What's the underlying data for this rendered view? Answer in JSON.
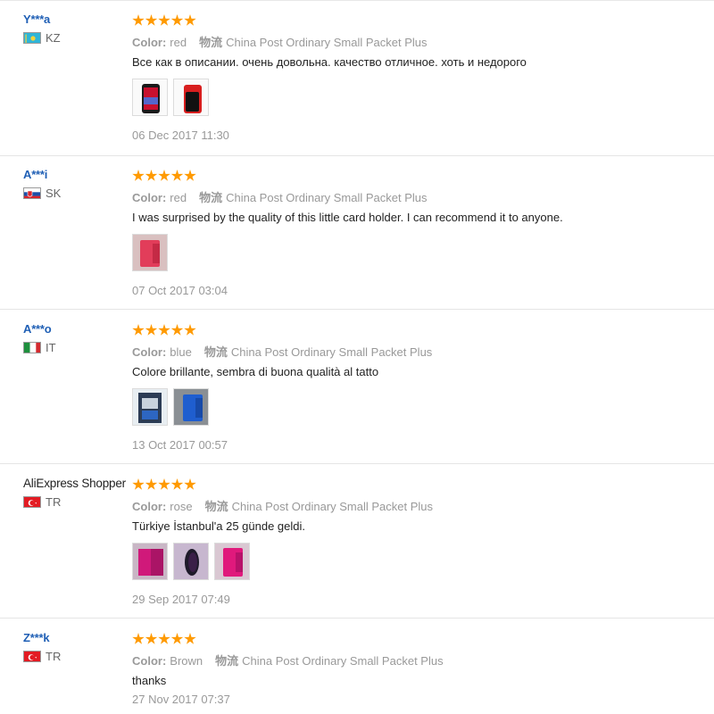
{
  "labels": {
    "color": "Color:",
    "logistics": "物流"
  },
  "reviews": [
    {
      "user": "Y***a",
      "country": "KZ",
      "flag": "kz",
      "rating": 5,
      "color": "red",
      "shipping": "China Post Ordinary Small Packet Plus",
      "text": "Все как в описании. очень довольна. качество отличное. хоть и недорого",
      "photos": [
        "phone-case-red-dark",
        "phone-case-red-black"
      ],
      "date": "06 Dec 2017 11:30"
    },
    {
      "user": "A***i",
      "country": "SK",
      "flag": "sk",
      "rating": 5,
      "color": "red",
      "shipping": "China Post Ordinary Small Packet Plus",
      "text": "I was surprised by the quality of this little card holder. I can recommend it to anyone.",
      "photos": [
        "card-holder-pink"
      ],
      "date": "07 Oct 2017 03:04"
    },
    {
      "user": "A***o",
      "country": "IT",
      "flag": "it",
      "rating": 5,
      "color": "blue",
      "shipping": "China Post Ordinary Small Packet Plus",
      "text": "Colore brillante, sembra di buona qualità al tatto",
      "photos": [
        "card-holder-blue-open",
        "card-holder-blue"
      ],
      "date": "13 Oct 2017 00:57"
    },
    {
      "user": "AliExpress Shopper",
      "country": "TR",
      "flag": "tr",
      "rating": 5,
      "color": "rose",
      "shipping": "China Post Ordinary Small Packet Plus",
      "text": "Türkiye İstanbul'a 25 günde geldi.",
      "photos": [
        "card-holder-rose-open",
        "card-holder-rose-dark",
        "card-holder-rose"
      ],
      "date": "29 Sep 2017 07:49"
    },
    {
      "user": "Z***k",
      "country": "TR",
      "flag": "tr",
      "rating": 5,
      "color": "Brown",
      "shipping": "China Post Ordinary Small Packet Plus",
      "text": "thanks",
      "photos": [],
      "date": "27 Nov 2017 07:37"
    }
  ],
  "colors": {
    "star": "#ff9a00",
    "username": "#1f5fb5",
    "meta": "#999999"
  }
}
